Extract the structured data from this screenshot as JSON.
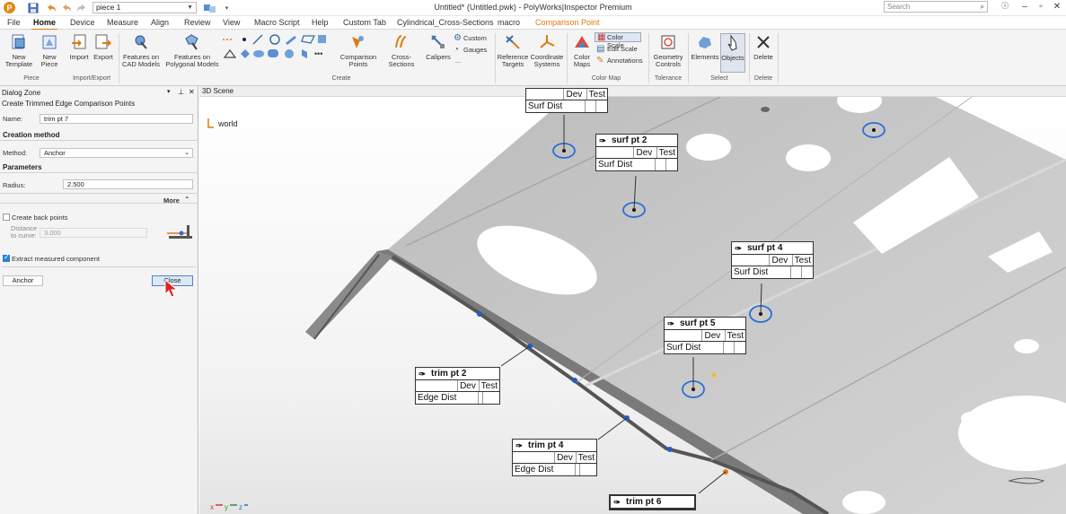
{
  "app": {
    "title": "Untitled* (Untitled.pwk) - PolyWorks|Inspector Premium",
    "piece_selector": "piece 1",
    "search_placeholder": "Search"
  },
  "menu": {
    "tabs": [
      "File",
      "Home",
      "Device",
      "Measure",
      "Align",
      "Review",
      "View",
      "Macro Script",
      "Help",
      "Custom Tab",
      "Cylindrical_Cross-Sections",
      "macro",
      "Comparison Point"
    ],
    "active": "Home"
  },
  "ribbon": {
    "new_template": "New\nTemplate",
    "new_piece": "New\nPiece",
    "import": "Import",
    "export": "Export",
    "features_cad": "Features on\nCAD Models",
    "features_poly": "Features on\nPolygonal Models",
    "comparison_points": "Comparison\nPoints",
    "cross_sections": "Cross-Sections",
    "calipers": "Calipers",
    "custom": "Custom",
    "gauges": "Gauges",
    "more": "...",
    "reference_targets": "Reference\nTargets",
    "coordinate_systems": "Coordinate\nSystems",
    "color_maps": "Color\nMaps",
    "color_scale": "Color Scale",
    "edit_scale": "Edit Scale",
    "annotations": "Annotations",
    "geometry_controls": "Geometry\nControls",
    "elements": "Elements",
    "objects": "Objects",
    "delete": "Delete",
    "groups": {
      "piece": "Piece",
      "import_export": "Import/Export",
      "create": "Create",
      "color_map": "Color Map",
      "tolerance": "Tolerance",
      "select": "Select",
      "delete": "Delete"
    }
  },
  "dialog": {
    "zone_title": "Dialog Zone",
    "title": "Create Trimmed Edge Comparison Points",
    "name_label": "Name:",
    "name_value": "trim pt 7",
    "creation_method": "Creation method",
    "method_label": "Method:",
    "method_value": "Anchor",
    "parameters": "Parameters",
    "radius_label": "Radius:",
    "radius_value": "2.500",
    "more": "More",
    "create_back_points": "Create back points",
    "create_back_points_checked": false,
    "distance_label": "Distance\nto curve:",
    "distance_value": "3.000",
    "extract_measured": "Extract measured component",
    "extract_measured_checked": true,
    "anchor_button": "Anchor",
    "close_button": "Close"
  },
  "scene": {
    "title": "3D Scene",
    "world_label": "world",
    "labels": [
      {
        "name": "",
        "rows": [
          [
            "",
            "Dev",
            "Test"
          ],
          [
            "Surf Dist",
            "",
            ""
          ]
        ]
      },
      {
        "name": "surf pt 2",
        "rows": [
          [
            "",
            "Dev",
            "Test"
          ],
          [
            "Surf Dist",
            "",
            ""
          ]
        ]
      },
      {
        "name": "surf pt 4",
        "rows": [
          [
            "",
            "Dev",
            "Test"
          ],
          [
            "Surf Dist",
            "",
            ""
          ]
        ]
      },
      {
        "name": "surf pt 5",
        "rows": [
          [
            "",
            "Dev",
            "Test"
          ],
          [
            "Surf Dist",
            "",
            ""
          ]
        ]
      },
      {
        "name": "trim pt 2",
        "rows": [
          [
            "",
            "Dev",
            "Test"
          ],
          [
            "Edge Dist",
            "",
            ""
          ]
        ]
      },
      {
        "name": "trim pt 4",
        "rows": [
          [
            "",
            "Dev",
            "Test"
          ],
          [
            "Edge Dist",
            "",
            ""
          ]
        ]
      },
      {
        "name": "trim pt 6",
        "rows": []
      }
    ]
  },
  "colors": {
    "accent": "#e07a10",
    "selection_blue": "#2b6fd6",
    "part_gray": "#c9c9c9"
  }
}
